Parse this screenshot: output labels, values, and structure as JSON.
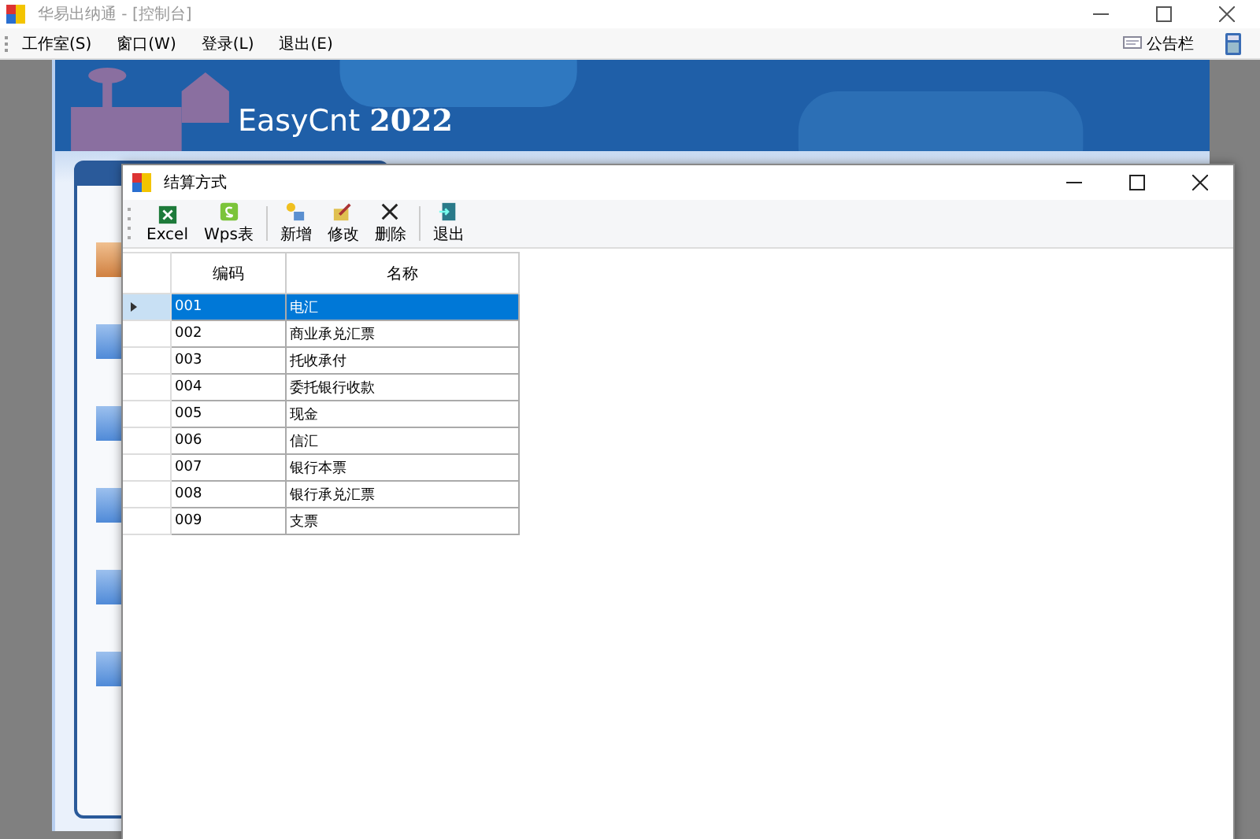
{
  "window": {
    "title": "华易出纳通 - [控制台]"
  },
  "menu": [
    "工作室(S)",
    "窗口(W)",
    "登录(L)",
    "退出(E)"
  ],
  "notice": {
    "label": "公告栏"
  },
  "banner": {
    "title": "EasyCnt",
    "year": "2022"
  },
  "child": {
    "title": "结算方式",
    "toolbar": [
      {
        "label": "Excel",
        "kind": "excel"
      },
      {
        "label": "Wps表",
        "kind": "wps"
      },
      {
        "kind": "sep"
      },
      {
        "label": "新增",
        "kind": "add"
      },
      {
        "label": "修改",
        "kind": "edit"
      },
      {
        "label": "删除",
        "kind": "delete"
      },
      {
        "kind": "sep"
      },
      {
        "label": "退出",
        "kind": "exit"
      }
    ],
    "table": {
      "columns": [
        "编码",
        "名称"
      ],
      "rows": [
        {
          "code": "001",
          "name": "电汇",
          "selected": true
        },
        {
          "code": "002",
          "name": "商业承兑汇票",
          "selected": false
        },
        {
          "code": "003",
          "name": "托收承付",
          "selected": false
        },
        {
          "code": "004",
          "name": "委托银行收款",
          "selected": false
        },
        {
          "code": "005",
          "name": "现金",
          "selected": false
        },
        {
          "code": "006",
          "name": "信汇",
          "selected": false
        },
        {
          "code": "007",
          "name": "银行本票",
          "selected": false
        },
        {
          "code": "008",
          "name": "银行承兑汇票",
          "selected": false
        },
        {
          "code": "009",
          "name": "支票",
          "selected": false
        }
      ]
    }
  }
}
